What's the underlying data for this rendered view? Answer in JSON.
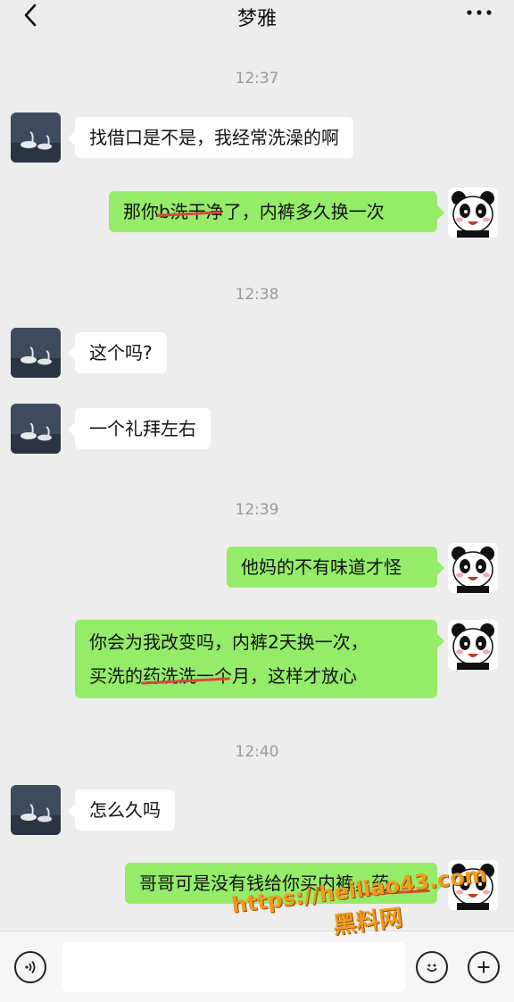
{
  "header": {
    "title": "梦雅",
    "back_icon": "chevron-left-icon",
    "more_icon": "more-dots-icon"
  },
  "timestamps": [
    "12:37",
    "12:38",
    "12:39",
    "12:40"
  ],
  "messages": [
    {
      "from": "other",
      "text": "找借口是不是，我经常洗澡的啊"
    },
    {
      "from": "me",
      "text": "那你b洗干净了，内裤多久换一次"
    },
    {
      "from": "other",
      "text": "这个吗?"
    },
    {
      "from": "other",
      "text": "一个礼拜左右"
    },
    {
      "from": "me",
      "text": "他妈的不有味道才怪"
    },
    {
      "from": "me",
      "line1": "你会为我改变吗，内裤2天换一次，",
      "line2": "买洗的药洗洗一个月，这样才放心"
    },
    {
      "from": "other",
      "text": "怎么久吗"
    },
    {
      "from": "me",
      "text": "哥哥可是没有钱给你买内裤，药"
    }
  ],
  "input_bar": {
    "voice_icon": "voice-icon",
    "emoji_icon": "emoji-icon",
    "plus_icon": "plus-icon",
    "text_value": ""
  },
  "watermark": {
    "url": "https://heiliao43.com",
    "name": "黑料网"
  },
  "colors": {
    "background": "#ededed",
    "my_bubble": "#95ec69",
    "other_bubble": "#ffffff",
    "timestamp": "#999999",
    "strike": "#d9483b",
    "watermark": "#f39a1e"
  }
}
